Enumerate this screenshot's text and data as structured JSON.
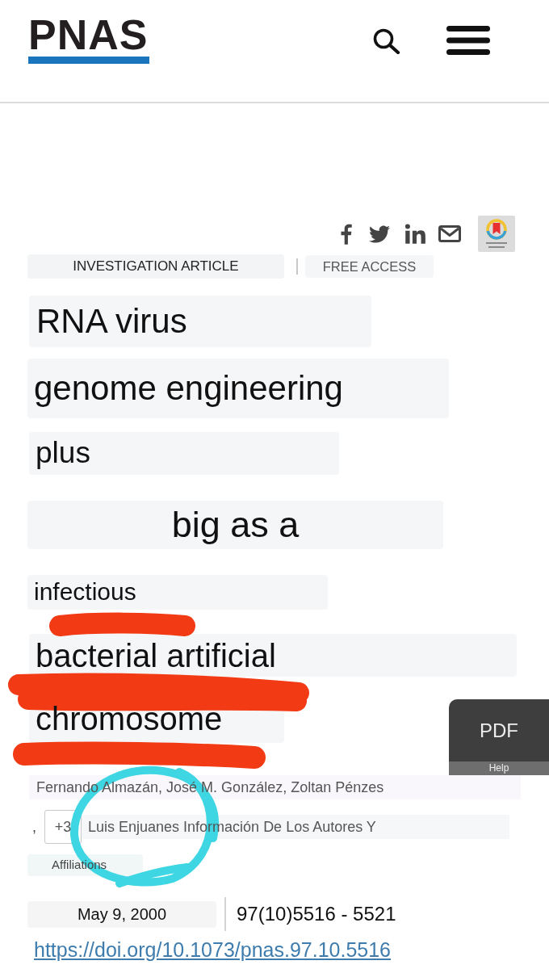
{
  "header": {
    "logo": "PNAS"
  },
  "tags": [
    {
      "label": "INVESTIGATION ARTICLE",
      "kind": "type"
    },
    {
      "label": "FREE ACCESS",
      "kind": "access"
    }
  ],
  "title_lines": [
    {
      "text": "RNA virus",
      "scribbled": false
    },
    {
      "text": "genome engineering",
      "scribbled": false
    },
    {
      "text": "plus",
      "scribbled": false
    },
    {
      "text": "big as a",
      "scribbled": false
    },
    {
      "text": "infectious",
      "scribbled": true
    },
    {
      "text": "bacterial artificial",
      "scribbled": true
    },
    {
      "text": "chromosome",
      "scribbled": true
    }
  ],
  "pdf_tab": {
    "label": "PDF",
    "help": "Help"
  },
  "authors": {
    "names": "Fernando Almazán, José M. González, Zoltan Pénzes",
    "separator": ",",
    "more": "+3",
    "last_line": "Luis Enjuanes Información De Los Autores Y",
    "affiliations": "Affiliations",
    "circled": true
  },
  "meta": {
    "date": "May 9, 2000",
    "pages": "97(10)5516 - 5521",
    "doi": "https://doi.org/10.1073/pnas.97.10.5516"
  }
}
